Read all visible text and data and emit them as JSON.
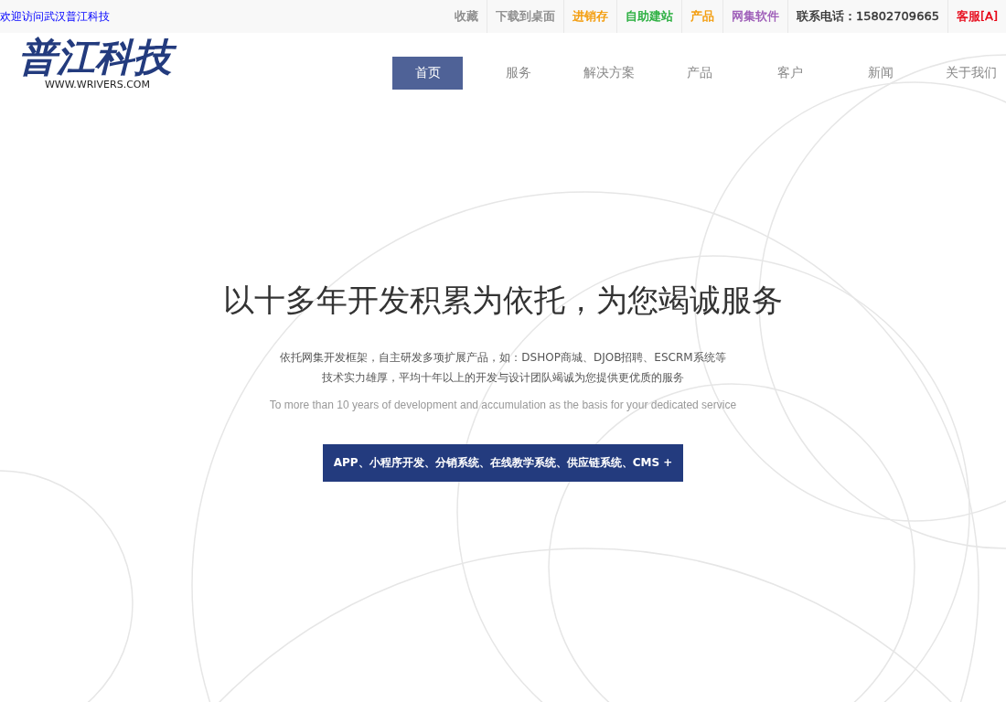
{
  "top_bar": {
    "welcome": "欢迎访问武汉普江科技",
    "links": [
      {
        "label": "收藏",
        "color": "#888888"
      },
      {
        "label": "下载到桌面",
        "color": "#888888"
      },
      {
        "label": "进销存",
        "color": "#f39800"
      },
      {
        "label": "自助建站",
        "color": "#22ac38"
      },
      {
        "label": "产品",
        "color": "#f39800"
      },
      {
        "label": "网集软件",
        "color": "#9b59b6"
      },
      {
        "label": "联系电话：15802709665",
        "color": "#333333"
      },
      {
        "label": "客服[A]",
        "color": "#e60012"
      }
    ]
  },
  "logo": {
    "name": "普江科技",
    "domain": "WWW.WRIVERS.COM"
  },
  "nav": [
    {
      "label": "首页",
      "selected": true
    },
    {
      "label": "服务",
      "selected": false
    },
    {
      "label": "解决方案",
      "selected": false
    },
    {
      "label": "产品",
      "selected": false
    },
    {
      "label": "客户",
      "selected": false
    },
    {
      "label": "新闻",
      "selected": false
    },
    {
      "label": "关于我们",
      "selected": false
    }
  ],
  "hero": {
    "title": "以十多年开发积累为依托，为您竭诚服务",
    "lines": [
      "依托网集开发框架，自主研发多项扩展产品，如：DSHOP商城、DJOB招聘、ESCRM系统等",
      "技术实力雄厚，平均十年以上的开发与设计团队竭诚为您提供更优质的服务"
    ],
    "english": "To more than 10 years of development and accumulation as the basis for your dedicated service",
    "button": "APP、小程序开发、分销系统、在线教学系统、供应链系统、CMS +"
  }
}
